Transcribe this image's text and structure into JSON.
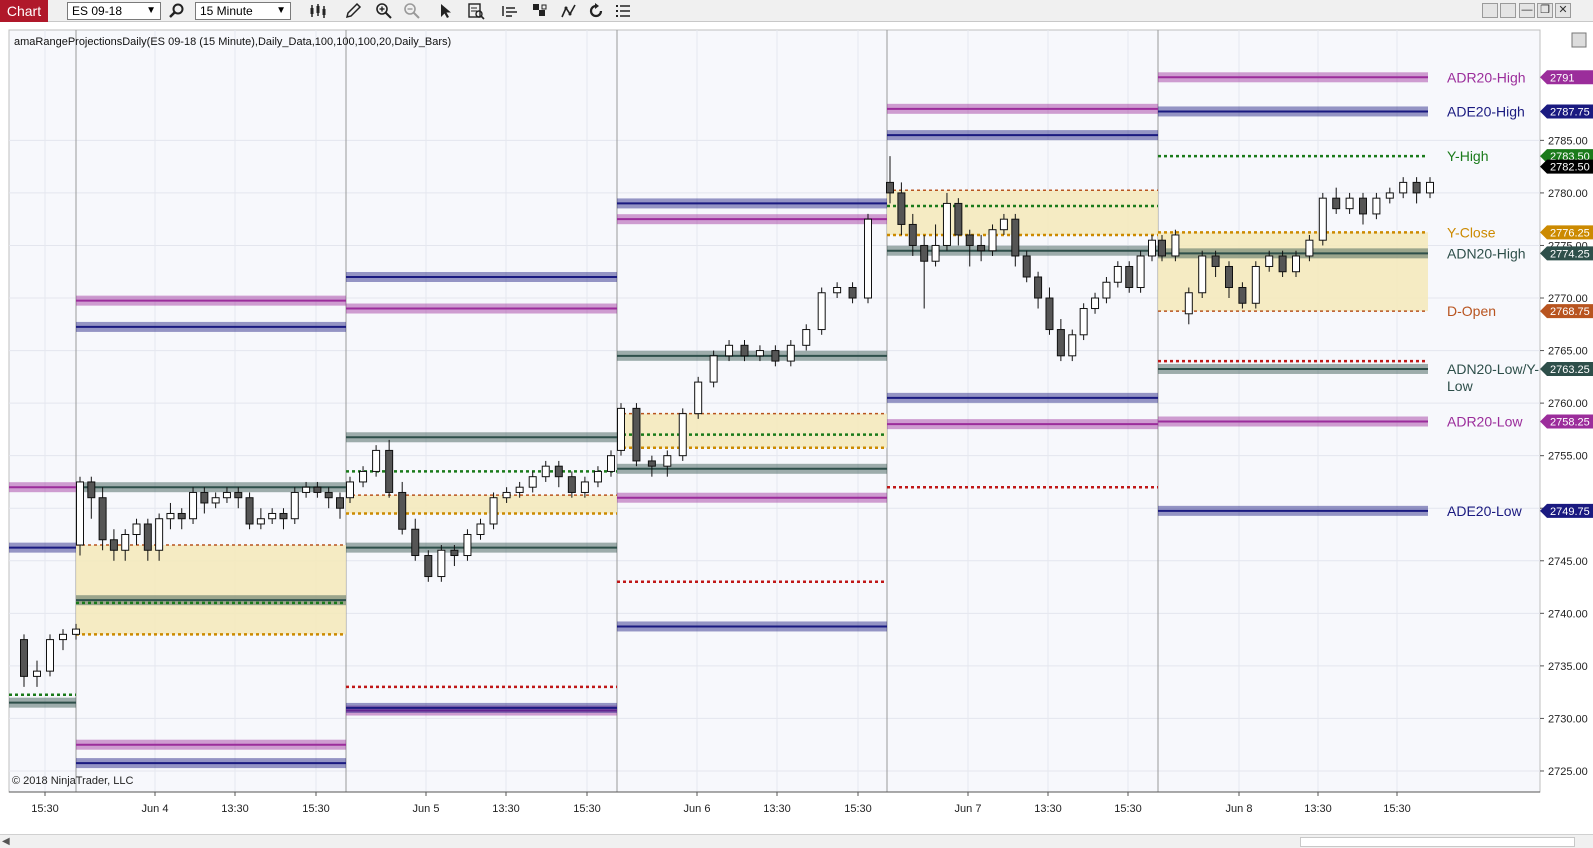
{
  "toolbar": {
    "tab_label": "Chart",
    "instrument": "ES 09-18",
    "interval": "15 Minute"
  },
  "chart_info": {
    "indicator_label": "amaRangeProjectionsDaily(ES 09-18 (15 Minute),Daily_Data,100,100,100,20,Daily_Bars)",
    "copyright": "© 2018 NinjaTrader, LLC"
  },
  "colors": {
    "adr": "#9b2d9b",
    "ade": "#1a1a80",
    "adn": "#2e4f4a",
    "y_high": "#1a7a1a",
    "y_close": "#cc8a00",
    "d_open": "#b8541f",
    "zone": "#f4e9b8",
    "low_dot": "#c01818"
  },
  "chart_data": {
    "type": "candlestick",
    "instrument": "ES 09-18",
    "interval": "15 Minute",
    "ylim": [
      2723.0,
      2795.5
    ],
    "y_ticks": [
      2725,
      2730,
      2735,
      2740,
      2745,
      2750,
      2755,
      2760,
      2765,
      2770,
      2775,
      2780,
      2785
    ],
    "y_tick_labels": [
      "2725.00",
      "2730.00",
      "2735.00",
      "2740.00",
      "2745.00",
      "2750.00",
      "2755.00",
      "2760.00",
      "2765.00",
      "2770.00",
      "2775.00",
      "2780.00",
      "2785.00"
    ],
    "x_ticks": [
      "15:30",
      "Jun 4",
      "13:30",
      "15:30",
      "Jun 5",
      "13:30",
      "15:30",
      "Jun 6",
      "13:30",
      "15:30",
      "Jun 7",
      "13:30",
      "15:30",
      "Jun 8",
      "13:30",
      "15:30"
    ],
    "sessions": [
      {
        "adr_high": 2752.0,
        "ade_high": 2746.25,
        "adn_high": 2731.5,
        "y_high": 2732.25
      },
      {
        "adr_high": 2769.75,
        "ade_high": 2767.25,
        "adn_high": 2752.0,
        "adn_low": 2741.25,
        "adr_low": 2727.5,
        "ade_low": 2725.75,
        "y_high": 2741.0,
        "y_close": 2738.0,
        "d_open": 2746.5,
        "zone": [
          2738.0,
          2746.5
        ]
      },
      {
        "adr_high": 2769.0,
        "ade_high": 2772.0,
        "adn_high": 2756.75,
        "adn_low": 2746.25,
        "adr_low": 2730.75,
        "ade_low": 2731.0,
        "y_high": 2753.5,
        "y_close": 2749.5,
        "d_open": 2751.25,
        "zone": [
          2749.5,
          2751.25
        ],
        "low_dot": 2733.0
      },
      {
        "adr_high": 2777.5,
        "ade_high": 2779.0,
        "adn_high": 2764.5,
        "adn_low": 2753.75,
        "adr_low": 2751.0,
        "ade_low": 2738.75,
        "y_high": 2757.0,
        "y_close": 2755.75,
        "d_open": 2759.0,
        "zone": [
          2755.75,
          2759.0
        ],
        "low_dot": 2743.0
      },
      {
        "adr_high": 2788.0,
        "ade_high": 2785.5,
        "adn_high": 2774.5,
        "adr_low": 2758.0,
        "ade_low": 2760.5,
        "y_high": 2778.75,
        "y_close": 2776.0,
        "d_open": 2780.25,
        "zone": [
          2776.0,
          2780.25
        ],
        "low_dot": 2752.0
      },
      {
        "adr_high": 2791.0,
        "ade_high": 2787.75,
        "adn_high": 2774.25,
        "adn_low": 2763.25,
        "adr_low": 2758.25,
        "ade_low": 2749.75,
        "y_high": 2783.5,
        "y_close": 2776.25,
        "d_open": 2768.75,
        "zone": [
          2768.75,
          2776.25
        ],
        "low_dot": 2764.0
      }
    ],
    "right_labels": [
      {
        "text": "ADR20-High",
        "value": 2791.0,
        "tag": "2791",
        "color_key": "adr"
      },
      {
        "text": "ADE20-High",
        "value": 2787.75,
        "tag": "2787.75",
        "color_key": "ade"
      },
      {
        "text": "Y-High",
        "value": 2783.5,
        "tag": "2783.50",
        "color_key": "y_high"
      },
      {
        "text": "Y-Close",
        "value": 2776.25,
        "tag": "2776.25",
        "color_key": "y_close"
      },
      {
        "text": "ADN20-High",
        "value": 2774.25,
        "tag": "2774.25",
        "color_key": "adn"
      },
      {
        "text": "D-Open",
        "value": 2768.75,
        "tag": "2768.75",
        "color_key": "d_open"
      },
      {
        "text": "ADN20-Low/Y-",
        "text2": "Low",
        "value": 2763.25,
        "tag": "2763.25",
        "color_key": "adn"
      },
      {
        "text": "ADR20-Low",
        "value": 2758.25,
        "tag": "2758.25",
        "color_key": "adr"
      },
      {
        "text": "ADE20-Low",
        "value": 2749.75,
        "tag": "2749.75",
        "color_key": "ade"
      }
    ],
    "last_price": {
      "value": 2782.5,
      "tag": "2782.50"
    },
    "candles": [
      [
        2737.5,
        2734.0,
        2738.0,
        2733.0
      ],
      [
        2734.0,
        2734.5,
        2735.5,
        2733.0
      ],
      [
        2734.5,
        2737.5,
        2738.0,
        2734.0
      ],
      [
        2737.5,
        2738.0,
        2738.5,
        2736.5
      ],
      [
        2738.0,
        2738.5,
        2739.0,
        2737.5
      ],
      [
        2746.5,
        2752.5,
        2753.0,
        2745.5
      ],
      [
        2752.5,
        2751.0,
        2753.0,
        2749.0
      ],
      [
        2751.0,
        2747.0,
        2752.0,
        2746.0
      ],
      [
        2747.0,
        2746.0,
        2748.0,
        2745.0
      ],
      [
        2746.0,
        2747.5,
        2748.0,
        2745.0
      ],
      [
        2747.5,
        2748.5,
        2749.0,
        2746.5
      ],
      [
        2748.5,
        2746.0,
        2749.0,
        2745.0
      ],
      [
        2746.0,
        2749.0,
        2749.5,
        2745.0
      ],
      [
        2749.0,
        2749.5,
        2750.5,
        2748.0
      ],
      [
        2749.5,
        2749.0,
        2750.0,
        2748.0
      ],
      [
        2749.0,
        2751.5,
        2752.0,
        2748.5
      ],
      [
        2751.5,
        2750.5,
        2752.0,
        2749.5
      ],
      [
        2750.5,
        2751.0,
        2751.5,
        2750.0
      ],
      [
        2751.0,
        2751.5,
        2752.0,
        2750.5
      ],
      [
        2751.5,
        2751.0,
        2752.0,
        2750.0
      ],
      [
        2751.0,
        2748.5,
        2751.5,
        2748.0
      ],
      [
        2748.5,
        2749.0,
        2750.0,
        2748.0
      ],
      [
        2749.0,
        2749.5,
        2750.0,
        2748.5
      ],
      [
        2749.5,
        2749.0,
        2750.0,
        2748.0
      ],
      [
        2749.0,
        2751.5,
        2752.0,
        2748.5
      ],
      [
        2751.5,
        2752.0,
        2752.5,
        2751.0
      ],
      [
        2752.0,
        2751.5,
        2752.5,
        2751.0
      ],
      [
        2751.5,
        2751.0,
        2752.0,
        2750.0
      ],
      [
        2751.0,
        2750.0,
        2751.5,
        2749.0
      ],
      [
        2751.0,
        2752.5,
        2753.0,
        2750.5
      ],
      [
        2752.5,
        2753.5,
        2754.0,
        2752.0
      ],
      [
        2753.5,
        2755.5,
        2756.0,
        2753.0
      ],
      [
        2755.5,
        2751.5,
        2756.5,
        2751.0
      ],
      [
        2751.5,
        2748.0,
        2752.5,
        2747.5
      ],
      [
        2748.0,
        2745.5,
        2749.0,
        2745.0
      ],
      [
        2745.5,
        2743.5,
        2746.0,
        2743.0
      ],
      [
        2743.5,
        2746.0,
        2746.5,
        2743.0
      ],
      [
        2746.0,
        2745.5,
        2746.5,
        2744.5
      ],
      [
        2745.5,
        2747.5,
        2748.0,
        2745.0
      ],
      [
        2747.5,
        2748.5,
        2749.0,
        2747.0
      ],
      [
        2748.5,
        2751.0,
        2751.5,
        2748.0
      ],
      [
        2751.0,
        2751.5,
        2752.0,
        2750.5
      ],
      [
        2751.5,
        2752.0,
        2752.5,
        2751.0
      ],
      [
        2752.0,
        2753.0,
        2753.5,
        2751.5
      ],
      [
        2753.0,
        2754.0,
        2754.5,
        2752.5
      ],
      [
        2754.0,
        2753.0,
        2754.5,
        2752.0
      ],
      [
        2753.0,
        2751.5,
        2753.5,
        2751.0
      ],
      [
        2751.5,
        2752.5,
        2753.0,
        2751.0
      ],
      [
        2752.5,
        2753.5,
        2754.0,
        2752.0
      ],
      [
        2753.5,
        2755.0,
        2755.5,
        2753.0
      ],
      [
        2755.5,
        2759.5,
        2760.0,
        2755.0
      ],
      [
        2759.5,
        2754.5,
        2760.0,
        2754.0
      ],
      [
        2754.5,
        2754.0,
        2755.0,
        2753.0
      ],
      [
        2754.0,
        2755.0,
        2755.5,
        2753.0
      ],
      [
        2755.0,
        2759.0,
        2759.5,
        2754.5
      ],
      [
        2759.0,
        2762.0,
        2762.5,
        2758.5
      ],
      [
        2762.0,
        2764.5,
        2765.0,
        2761.5
      ],
      [
        2764.5,
        2765.5,
        2766.0,
        2764.0
      ],
      [
        2765.5,
        2764.5,
        2766.0,
        2764.0
      ],
      [
        2764.5,
        2765.0,
        2765.5,
        2764.0
      ],
      [
        2765.0,
        2764.0,
        2765.5,
        2763.5
      ],
      [
        2764.0,
        2765.5,
        2766.0,
        2763.5
      ],
      [
        2765.5,
        2767.0,
        2767.5,
        2765.0
      ],
      [
        2767.0,
        2770.5,
        2771.0,
        2766.5
      ],
      [
        2770.5,
        2771.0,
        2771.5,
        2770.0
      ],
      [
        2771.0,
        2770.0,
        2771.5,
        2769.5
      ],
      [
        2770.0,
        2777.5,
        2778.0,
        2769.5
      ],
      [
        2781.0,
        2780.0,
        2783.5,
        2779.0
      ],
      [
        2780.0,
        2777.0,
        2781.0,
        2776.0
      ],
      [
        2777.0,
        2775.0,
        2778.0,
        2774.0
      ],
      [
        2775.0,
        2773.5,
        2776.0,
        2769.0
      ],
      [
        2773.5,
        2775.0,
        2777.0,
        2773.0
      ],
      [
        2775.0,
        2779.0,
        2780.0,
        2774.5
      ],
      [
        2779.0,
        2776.0,
        2779.5,
        2775.0
      ],
      [
        2776.0,
        2775.0,
        2776.5,
        2773.0
      ],
      [
        2775.0,
        2774.5,
        2776.0,
        2773.5
      ],
      [
        2774.5,
        2776.5,
        2777.0,
        2774.0
      ],
      [
        2776.5,
        2777.5,
        2778.0,
        2776.0
      ],
      [
        2777.5,
        2774.0,
        2778.0,
        2773.0
      ],
      [
        2774.0,
        2772.0,
        2774.5,
        2771.5
      ],
      [
        2772.0,
        2770.0,
        2772.5,
        2769.0
      ],
      [
        2770.0,
        2767.0,
        2771.0,
        2766.5
      ],
      [
        2767.0,
        2764.5,
        2768.0,
        2764.0
      ],
      [
        2764.5,
        2766.5,
        2767.0,
        2764.0
      ],
      [
        2766.5,
        2769.0,
        2769.5,
        2766.0
      ],
      [
        2769.0,
        2770.0,
        2770.5,
        2768.5
      ],
      [
        2770.0,
        2771.5,
        2772.0,
        2769.5
      ],
      [
        2771.5,
        2773.0,
        2773.5,
        2771.0
      ],
      [
        2773.0,
        2771.0,
        2773.5,
        2770.5
      ],
      [
        2771.0,
        2774.0,
        2774.5,
        2770.5
      ],
      [
        2774.0,
        2775.5,
        2776.0,
        2773.5
      ],
      [
        2775.5,
        2774.0,
        2776.0,
        2773.5
      ],
      [
        2774.0,
        2776.0,
        2776.5,
        2773.5
      ],
      [
        2768.5,
        2770.5,
        2771.0,
        2767.5
      ],
      [
        2770.5,
        2774.0,
        2774.5,
        2770.0
      ],
      [
        2774.0,
        2773.0,
        2774.5,
        2772.0
      ],
      [
        2773.0,
        2771.0,
        2773.5,
        2770.0
      ],
      [
        2771.0,
        2769.5,
        2771.5,
        2769.0
      ],
      [
        2769.5,
        2773.0,
        2773.5,
        2769.0
      ],
      [
        2773.0,
        2774.0,
        2774.5,
        2772.5
      ],
      [
        2774.0,
        2772.5,
        2774.5,
        2772.0
      ],
      [
        2772.5,
        2774.0,
        2774.5,
        2772.0
      ],
      [
        2774.0,
        2775.5,
        2776.0,
        2773.5
      ],
      [
        2775.5,
        2779.5,
        2780.0,
        2775.0
      ],
      [
        2779.5,
        2778.5,
        2780.5,
        2778.0
      ],
      [
        2778.5,
        2779.5,
        2780.0,
        2778.0
      ],
      [
        2779.5,
        2778.0,
        2780.0,
        2777.0
      ],
      [
        2778.0,
        2779.5,
        2780.0,
        2777.5
      ],
      [
        2779.5,
        2780.0,
        2780.5,
        2779.0
      ],
      [
        2780.0,
        2781.0,
        2781.5,
        2779.5
      ],
      [
        2781.0,
        2780.0,
        2781.5,
        2779.0
      ],
      [
        2780.0,
        2781.0,
        2781.5,
        2779.5
      ],
      [
        2781.0,
        2780.5,
        2781.5,
        2780.0
      ],
      [
        2780.5,
        2781.5,
        2782.0,
        2780.0
      ],
      [
        2781.5,
        2782.5,
        2783.0,
        2781.0
      ]
    ]
  }
}
